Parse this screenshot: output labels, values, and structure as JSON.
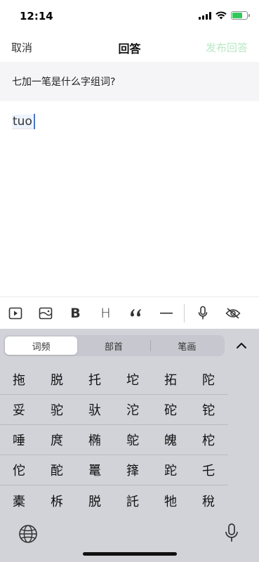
{
  "status": {
    "time": "12:14",
    "battery_level": 0.7,
    "battery_color": "#34c759"
  },
  "nav": {
    "cancel": "取消",
    "title": "回答",
    "publish": "发布回答",
    "publish_color": "#b8e9c4"
  },
  "question": {
    "text": "七加一笔是什么字组词?"
  },
  "answer": {
    "composing_text": "tuo"
  },
  "toolbar": {
    "icons": [
      "video-icon",
      "image-icon",
      "bold-icon",
      "heading-icon",
      "quote-icon",
      "divider-icon",
      "microphone-icon",
      "eye-hide-icon"
    ],
    "bold_label": "B",
    "heading_label": "H"
  },
  "keyboard": {
    "tabs": [
      "词频",
      "部首",
      "笔画"
    ],
    "active_tab": "词频",
    "candidates": [
      [
        "拖",
        "脱",
        "托",
        "坨",
        "拓",
        "陀"
      ],
      [
        "妥",
        "驼",
        "驮",
        "沱",
        "砣",
        "铊"
      ],
      [
        "唾",
        "庹",
        "椭",
        "鸵",
        "魄",
        "柁"
      ],
      [
        "佗",
        "酡",
        "鼍",
        "箨",
        "跎",
        "乇"
      ],
      [
        "橐",
        "柝",
        "脱",
        "託",
        "牠",
        "稅"
      ]
    ]
  }
}
